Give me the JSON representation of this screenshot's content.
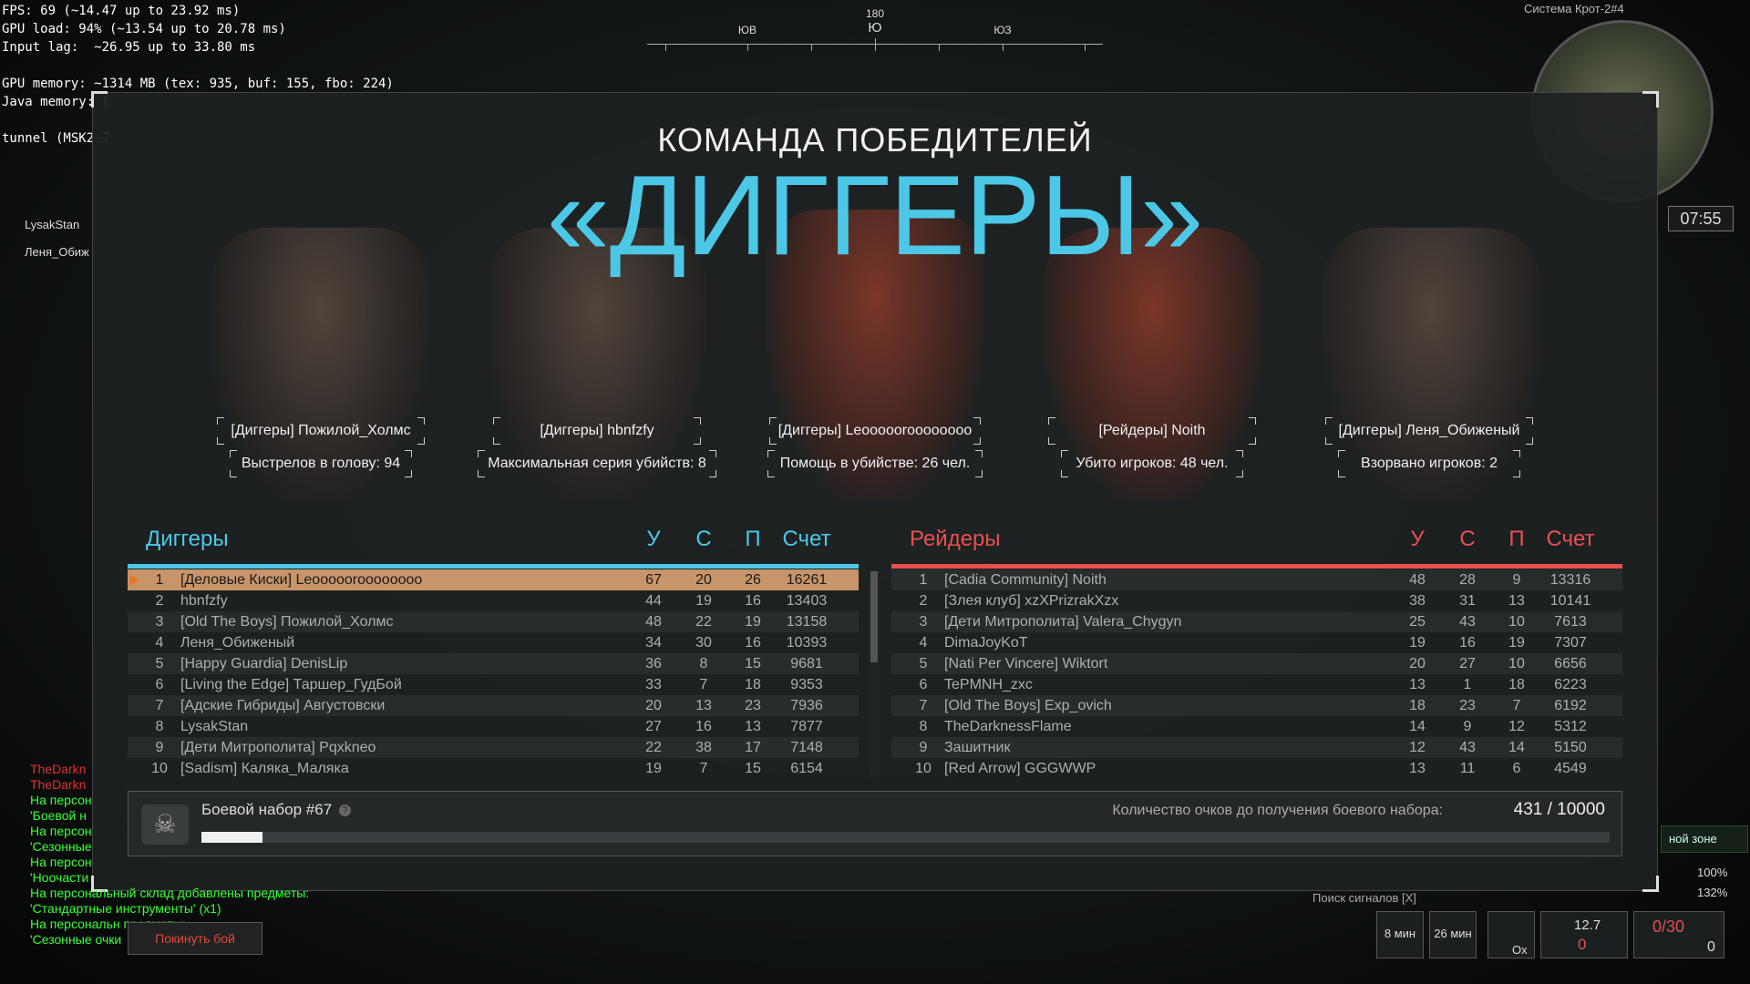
{
  "debug": [
    "FPS: 69 (~14.47 up to 23.92 ms)",
    "GPU load: 94% (~13.54 up to 20.78 ms)",
    "Input lag:  ~26.95 up to 33.80 ms",
    "",
    "GPU memory: ~1314 MB (tex: 935, buf: 155, fbo: 224)",
    "Java memory: (",
    "",
    "tunnel (MSK2-7"
  ],
  "left_names": [
    "LysakStan",
    "Леня_Обиж"
  ],
  "chat": [
    {
      "text": "TheDarkn",
      "color": "#e03030"
    },
    {
      "text": "TheDarkn",
      "color": "#e03030"
    },
    {
      "text": "На персон",
      "color": "#3aff3a"
    },
    {
      "text": "'Боевой н",
      "color": "#3aff3a"
    },
    {
      "text": "На персон",
      "color": "#3aff3a"
    },
    {
      "text": "'Сезонные",
      "color": "#3aff3a"
    },
    {
      "text": "На персон",
      "color": "#3aff3a"
    },
    {
      "text": "'Ноочасти",
      "color": "#3aff3a"
    },
    {
      "text": "На персональный склад добавлены предметы:",
      "color": "#3aff3a"
    },
    {
      "text": "'Стандартные инструменты' (x1)",
      "color": "#3aff3a"
    },
    {
      "text": "На персональн          предметы:",
      "color": "#3aff3a"
    },
    {
      "text": "'Сезонные очки",
      "color": "#3aff3a"
    }
  ],
  "compass": {
    "top": "180",
    "marks": [
      "ЮВ",
      "Ю",
      "ЮЗ"
    ]
  },
  "minimap": {
    "system": "Система Крот-2#4",
    "time": "07:55"
  },
  "title": {
    "line1": "КОМАНДА ПОБЕДИТЕЛЕЙ",
    "line2": "«ДИГГЕРЫ»"
  },
  "mvps": [
    {
      "name": "[Диггеры] Пожилой_Холмс",
      "stat": "Выстрелов в голову: 94"
    },
    {
      "name": "[Диггеры] hbnfzfy",
      "stat": "Максимальная серия убийств: 8"
    },
    {
      "name": "[Диггеры] Leoooooroooooooo",
      "stat": "Помощь в убийстве: 26 чел."
    },
    {
      "name": "[Рейдеры] Noith",
      "stat": "Убито игроков: 48 чел."
    },
    {
      "name": "[Диггеры] Леня_Обиженый",
      "stat": "Взорвано игроков: 2"
    }
  ],
  "teams": {
    "left": {
      "name": "Диггеры",
      "color": "#4cc8e6",
      "cols": [
        "У",
        "С",
        "П",
        "Счет"
      ],
      "rows": [
        [
          "1",
          "[Деловые Киски] Leoooooroooooooo",
          "67",
          "20",
          "26",
          "16261"
        ],
        [
          "2",
          "hbnfzfy",
          "44",
          "19",
          "16",
          "13403"
        ],
        [
          "3",
          "[Old The Boys] Пожилой_Холмс",
          "48",
          "22",
          "19",
          "13158"
        ],
        [
          "4",
          "Леня_Обиженый",
          "34",
          "30",
          "16",
          "10393"
        ],
        [
          "5",
          "[Happy Guardia] DenisLip",
          "36",
          "8",
          "15",
          "9681"
        ],
        [
          "6",
          "[Living the Edge] Таршер_ГудБой",
          "33",
          "7",
          "18",
          "9353"
        ],
        [
          "7",
          "[Адские Гибриды] Августовски",
          "20",
          "13",
          "23",
          "7936"
        ],
        [
          "8",
          "LysakStan",
          "27",
          "16",
          "13",
          "7877"
        ],
        [
          "9",
          "[Дети Митрополита] Pqxkneo",
          "22",
          "38",
          "17",
          "7148"
        ],
        [
          "10",
          "[Sadism] Каляка_Маляка",
          "19",
          "7",
          "15",
          "6154"
        ]
      ]
    },
    "right": {
      "name": "Рейдеры",
      "color": "#e85050",
      "cols": [
        "У",
        "С",
        "П",
        "Счет"
      ],
      "rows": [
        [
          "1",
          "[Cadia Community] Noith",
          "48",
          "28",
          "9",
          "13316"
        ],
        [
          "2",
          "[Злея клуб] xzXPrizrakXzx",
          "38",
          "31",
          "13",
          "10141"
        ],
        [
          "3",
          "[Дети Митрополита] Valera_Chygyn",
          "25",
          "43",
          "10",
          "7613"
        ],
        [
          "4",
          "DimaJoyKoT",
          "19",
          "16",
          "19",
          "7307"
        ],
        [
          "5",
          "[Nati Per Vincere] Wiktort",
          "20",
          "27",
          "10",
          "6656"
        ],
        [
          "6",
          "TePMNH_zxc",
          "13",
          "1",
          "18",
          "6223"
        ],
        [
          "7",
          "[Old The Boys] Exp_ovich",
          "18",
          "23",
          "7",
          "6192"
        ],
        [
          "8",
          "TheDarknessFlame",
          "14",
          "9",
          "12",
          "5312"
        ],
        [
          "9",
          "Зашитник",
          "12",
          "43",
          "14",
          "5150"
        ],
        [
          "10",
          "[Red Arrow] GGGWWP",
          "13",
          "11",
          "6",
          "4549"
        ]
      ]
    }
  },
  "battle_kit": {
    "name": "Боевой набор #67",
    "points_label": "Количество очков до получения боевого набора:",
    "points": "431 / 10000",
    "progress": 0.0431
  },
  "leave_label": "Покинуть бой",
  "hud": {
    "zone": "ной зоне",
    "pct1": "100%",
    "pct2": "132%",
    "signal": "Поиск сигналов [X]",
    "t1": "8 мин",
    "t2": "26 мин",
    "ox": "Ox",
    "speed": "12.7",
    "zero": "0",
    "ammo": "0/30",
    "ammo2": "0"
  }
}
